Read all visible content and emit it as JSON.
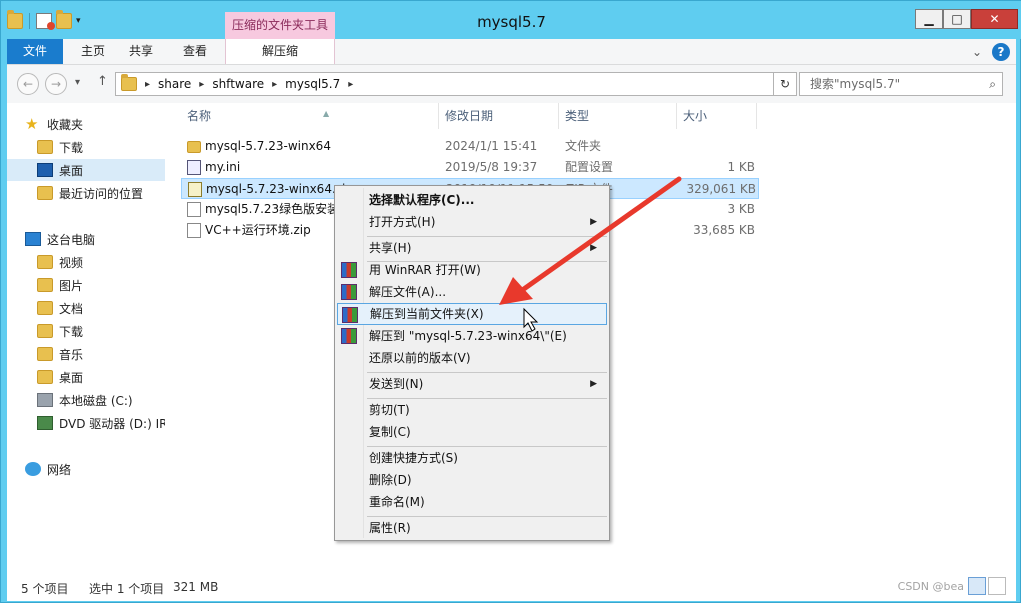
{
  "window": {
    "title": "mysql5.7",
    "context_tab_group": "压缩的文件夹工具",
    "colors": {
      "frame": "#5fcdf0",
      "file_tab": "#1a7ccd",
      "context_group": "#f7c9df",
      "selection": "#cce8ff",
      "close": "#c9403a"
    }
  },
  "window_buttons": {
    "minimize": "▁",
    "maximize": "□",
    "close": "✕"
  },
  "ribbon": {
    "tabs": [
      "文件",
      "主页",
      "共享",
      "查看",
      "解压缩"
    ],
    "collapse_icon": "⌄",
    "help_icon": "?"
  },
  "nav": {
    "back": "←",
    "forward": "→",
    "dropdown": "▾",
    "up": "↑",
    "breadcrumb": [
      "share",
      "shftware",
      "mysql5.7"
    ],
    "crumb_sep": "▸",
    "addr_dropdown": "▾",
    "refresh": "↻",
    "search_placeholder": "搜索\"mysql5.7\"",
    "search_icon": "⌕"
  },
  "sidebar": {
    "favorites": "收藏夹",
    "favorites_items": [
      "下载",
      "桌面",
      "最近访问的位置"
    ],
    "this_pc": "这台电脑",
    "this_pc_items": [
      "视频",
      "图片",
      "文档",
      "下载",
      "音乐",
      "桌面",
      "本地磁盘 (C:)",
      "DVD 驱动器 (D:) IR"
    ],
    "network": "网络"
  },
  "columns": [
    "名称",
    "修改日期",
    "类型",
    "大小"
  ],
  "files": [
    {
      "name": "mysql-5.7.23-winx64",
      "date": "2024/1/1 15:41",
      "type": "文件夹",
      "size": ""
    },
    {
      "name": "my.ini",
      "date": "2019/5/8 19:37",
      "type": "配置设置",
      "size": "1 KB"
    },
    {
      "name": "mysql-5.7.23-winx64.zip",
      "date": "2019/10/11 15:50",
      "type": "ZIP 文件",
      "size": "329,061 KB"
    },
    {
      "name": "mysql5.7.23绿色版安装",
      "date": "",
      "type": "",
      "size": "3 KB"
    },
    {
      "name": "VC++运行环境.zip",
      "date": "",
      "type": "",
      "size": "33,685 KB"
    }
  ],
  "context_menu": {
    "items": [
      {
        "label": "选择默认程序(C)..."
      },
      {
        "label": "打开方式(H)"
      },
      {
        "label": "共享(H)"
      },
      {
        "label": "用 WinRAR 打开(W)"
      },
      {
        "label": "解压文件(A)..."
      },
      {
        "label": "解压到当前文件夹(X)"
      },
      {
        "label": "解压到 \"mysql-5.7.23-winx64\\\"(E)"
      },
      {
        "label": "还原以前的版本(V)"
      },
      {
        "label": "发送到(N)"
      },
      {
        "label": "剪切(T)"
      },
      {
        "label": "复制(C)"
      },
      {
        "label": "创建快捷方式(S)"
      },
      {
        "label": "删除(D)"
      },
      {
        "label": "重命名(M)"
      },
      {
        "label": "属性(R)"
      }
    ],
    "submenu_arrow": "▶",
    "highlighted": "解压到当前文件夹(X)"
  },
  "status": {
    "count": "5 个项目",
    "selected": "选中 1 个项目",
    "size": "321 MB",
    "watermark": "CSDN @bea"
  }
}
